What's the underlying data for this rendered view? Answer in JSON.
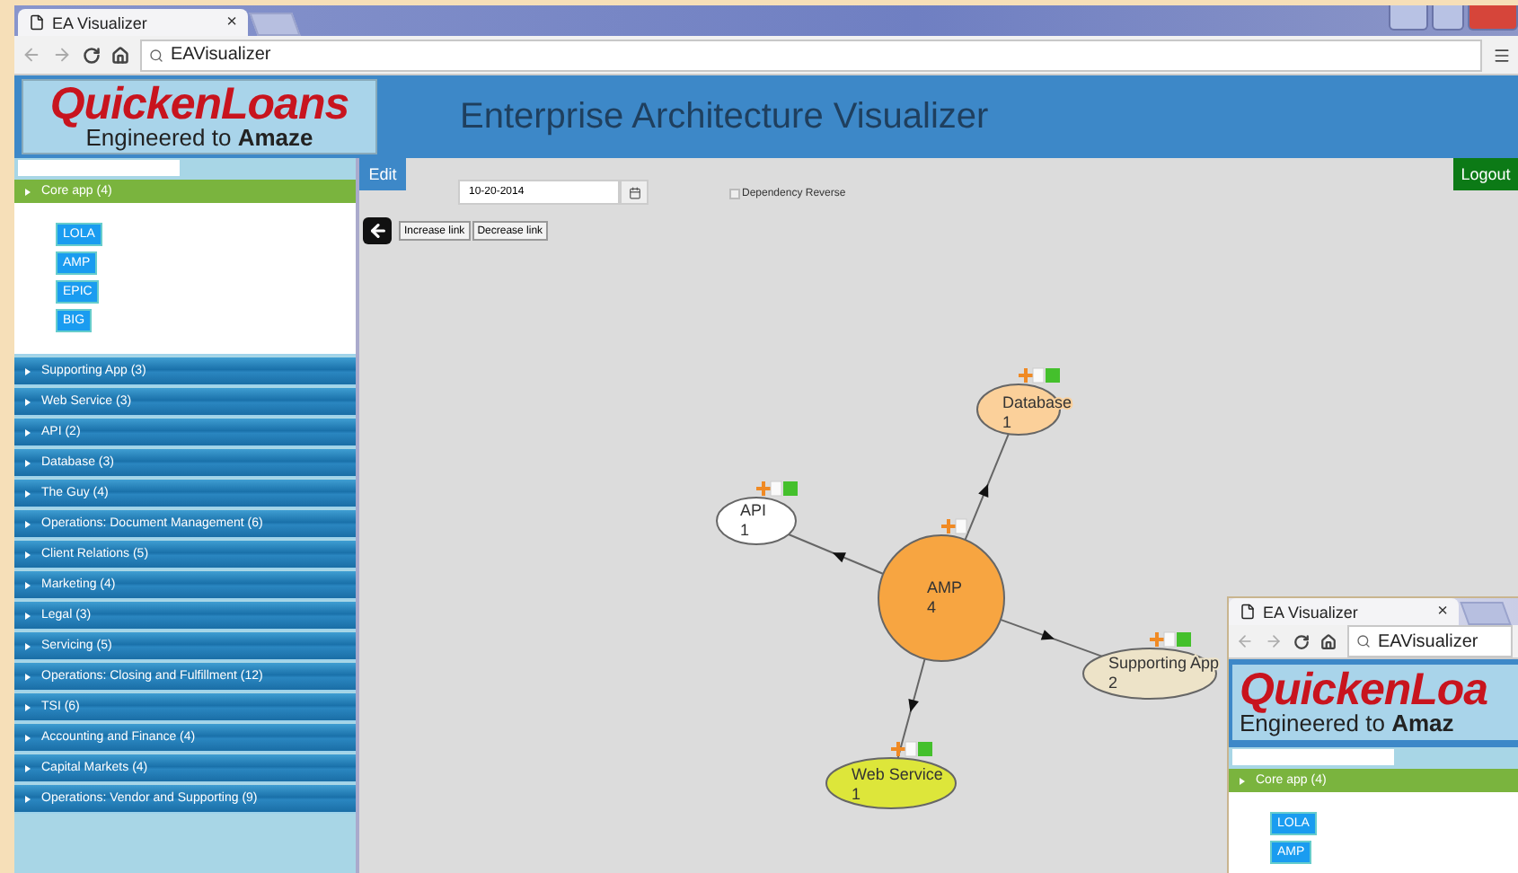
{
  "browser": {
    "tab_title": "EA Visualizer",
    "tab_close": "×",
    "address": "EAVisualizer"
  },
  "header": {
    "logo_brand": "QuickenLoans",
    "logo_tagline": "Engineered to **Amaze**",
    "title": "Enterprise Architecture Visualizer"
  },
  "sidebar": {
    "groups": [
      {
        "label": "Core app (4)",
        "expanded": true,
        "items": [
          "LOLA",
          "AMP",
          "EPIC",
          "BIG"
        ]
      },
      {
        "label": "Supporting App (3)",
        "expanded": false
      },
      {
        "label": "Web Service (3)",
        "expanded": false
      },
      {
        "label": "API (2)",
        "expanded": false
      },
      {
        "label": "Database (3)",
        "expanded": false
      },
      {
        "label": "The Guy (4)",
        "expanded": false
      },
      {
        "label": "Operations: Document Management (6)",
        "expanded": false
      },
      {
        "label": "Client Relations (5)",
        "expanded": false
      },
      {
        "label": "Marketing (4)",
        "expanded": false
      },
      {
        "label": "Legal (3)",
        "expanded": false
      },
      {
        "label": "Servicing (5)",
        "expanded": false
      },
      {
        "label": "Operations: Closing and Fulfillment (12)",
        "expanded": false
      },
      {
        "label": "TSI (6)",
        "expanded": false
      },
      {
        "label": "Accounting and Finance (4)",
        "expanded": false
      },
      {
        "label": "Capital Markets (4)",
        "expanded": false
      },
      {
        "label": "Operations: Vendor and Supporting (9)",
        "expanded": false
      }
    ]
  },
  "toolbar": {
    "edit": "Edit",
    "logout": "Logout",
    "date": "10-20-2014",
    "dependency_reverse": {
      "label": "Dependency Reverse",
      "checked": false
    },
    "increase": "Increase link",
    "decrease": "Decrease link"
  },
  "graph": {
    "nodes": [
      {
        "label": "API",
        "count": "1",
        "color": "#ffffff",
        "kind": "dependency"
      },
      {
        "label": "Database",
        "count": "1",
        "color": "#fbd09a",
        "kind": "dependency"
      },
      {
        "label": "AMP",
        "count": "4",
        "color": "#f7a541",
        "kind": "center"
      },
      {
        "label": "Supporting App",
        "count": "2",
        "color": "#ede3c8",
        "kind": "dependency"
      },
      {
        "label": "Web Service",
        "count": "1",
        "color": "#dde63a",
        "kind": "dependency"
      }
    ]
  },
  "inset_window": {
    "tab_title": "EA Visualizer",
    "tab_close": "×",
    "address": "EAVisualizer",
    "logo_brand": "QuickenLoa",
    "logo_tagline": "Engineered to **Amaz**",
    "group": "Core app (4)",
    "items": [
      "LOLA",
      "AMP"
    ]
  }
}
